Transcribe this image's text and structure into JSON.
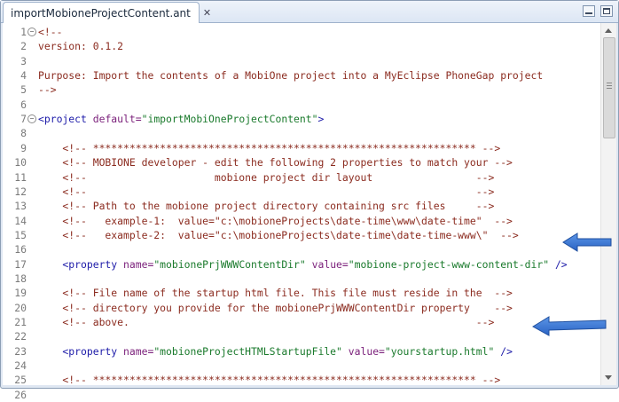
{
  "tab": {
    "title": "importMobioneProjectContent.ant",
    "close": "✕"
  },
  "icons": {
    "tab": "ant-file-icon",
    "arrow1": "blue-arrow-icon",
    "arrow2": "blue-arrow-icon"
  },
  "colors": {
    "comment": "#8b2b1f",
    "tag": "#1c1aa8",
    "attr": "#7a1f7a",
    "value": "#1a7a2c",
    "arrow": "#2e6fd0"
  },
  "lines": [
    {
      "n": "1",
      "fold": true,
      "parts": [
        {
          "t": "<!--",
          "c": "c-comment"
        }
      ]
    },
    {
      "n": "2",
      "fold": false,
      "parts": [
        {
          "t": "version: 0.1.2",
          "c": "c-comment"
        }
      ]
    },
    {
      "n": "3",
      "fold": false,
      "parts": []
    },
    {
      "n": "4",
      "fold": false,
      "parts": [
        {
          "t": "Purpose: Import the contents of a MobiOne project into a MyEclipse PhoneGap project",
          "c": "c-comment"
        }
      ]
    },
    {
      "n": "5",
      "fold": false,
      "parts": [
        {
          "t": "-->",
          "c": "c-comment"
        }
      ]
    },
    {
      "n": "6",
      "fold": false,
      "parts": []
    },
    {
      "n": "7",
      "fold": true,
      "parts": [
        {
          "t": "<project ",
          "c": "c-tag"
        },
        {
          "t": "default=",
          "c": "c-attr"
        },
        {
          "t": "\"importMobiOneProjectContent\"",
          "c": "c-val"
        },
        {
          "t": ">",
          "c": "c-tag"
        }
      ]
    },
    {
      "n": "8",
      "fold": false,
      "parts": []
    },
    {
      "n": "9",
      "fold": false,
      "parts": [
        {
          "t": "    <!-- *************************************************************** -->",
          "c": "c-comment"
        }
      ]
    },
    {
      "n": "10",
      "fold": false,
      "parts": [
        {
          "t": "    <!-- MOBIONE developer - edit the following 2 properties to match your -->",
          "c": "c-comment"
        }
      ]
    },
    {
      "n": "11",
      "fold": false,
      "parts": [
        {
          "t": "    <!--                     mobione project dir layout                 -->",
          "c": "c-comment"
        }
      ]
    },
    {
      "n": "12",
      "fold": false,
      "parts": [
        {
          "t": "    <!--                                                                -->",
          "c": "c-comment"
        }
      ]
    },
    {
      "n": "13",
      "fold": false,
      "parts": [
        {
          "t": "    <!-- Path to the mobione project directory containing src files     -->",
          "c": "c-comment"
        }
      ]
    },
    {
      "n": "14",
      "fold": false,
      "parts": [
        {
          "t": "    <!--   example-1:  value=\"c:\\mobioneProjects\\date-time\\www\\date-time\"  -->",
          "c": "c-comment"
        }
      ]
    },
    {
      "n": "15",
      "fold": false,
      "parts": [
        {
          "t": "    <!--   example-2:  value=\"c:\\mobioneProjects\\date-time\\date-time-www\\\"  -->",
          "c": "c-comment"
        }
      ]
    },
    {
      "n": "16",
      "fold": false,
      "parts": []
    },
    {
      "n": "17",
      "fold": false,
      "parts": [
        {
          "t": "    <property ",
          "c": "c-tag"
        },
        {
          "t": "name=",
          "c": "c-attr"
        },
        {
          "t": "\"mobionePrjWWWContentDir\"",
          "c": "c-val"
        },
        {
          "t": " value=",
          "c": "c-attr"
        },
        {
          "t": "\"mobione-project-www-content-dir\"",
          "c": "c-val"
        },
        {
          "t": " />",
          "c": "c-tag"
        }
      ]
    },
    {
      "n": "18",
      "fold": false,
      "parts": []
    },
    {
      "n": "19",
      "fold": false,
      "parts": [
        {
          "t": "    <!-- File name of the startup html file. This file must reside in the  -->",
          "c": "c-comment"
        }
      ]
    },
    {
      "n": "20",
      "fold": false,
      "parts": [
        {
          "t": "    <!-- directory you provide for the mobionePrjWWWContentDir property    -->",
          "c": "c-comment"
        }
      ]
    },
    {
      "n": "21",
      "fold": false,
      "parts": [
        {
          "t": "    <!-- above.                                                         -->",
          "c": "c-comment"
        }
      ]
    },
    {
      "n": "22",
      "fold": false,
      "parts": []
    },
    {
      "n": "23",
      "fold": false,
      "parts": [
        {
          "t": "    <property ",
          "c": "c-tag"
        },
        {
          "t": "name=",
          "c": "c-attr"
        },
        {
          "t": "\"mobioneProjectHTMLStartupFile\"",
          "c": "c-val"
        },
        {
          "t": " value=",
          "c": "c-attr"
        },
        {
          "t": "\"yourstartup.html\"",
          "c": "c-val"
        },
        {
          "t": " />",
          "c": "c-tag"
        }
      ]
    },
    {
      "n": "24",
      "fold": false,
      "parts": []
    },
    {
      "n": "25",
      "fold": false,
      "parts": [
        {
          "t": "    <!-- *************************************************************** -->",
          "c": "c-comment"
        }
      ]
    },
    {
      "n": "26",
      "fold": false,
      "parts": []
    }
  ]
}
